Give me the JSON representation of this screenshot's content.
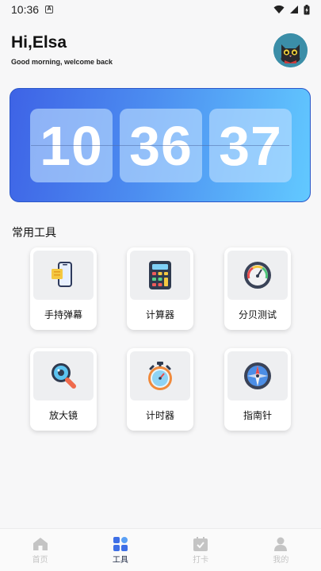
{
  "status_bar": {
    "time": "10:36",
    "notification_icon": "a-notification-icon",
    "wifi_icon": "wifi-icon",
    "signal_icon": "signal-icon",
    "battery_icon": "battery-charging-icon"
  },
  "header": {
    "greeting": "Hi,Elsa",
    "subtitle": "Good morning, welcome back",
    "avatar_icon": "cat-avatar-icon"
  },
  "clock": {
    "hours": "10",
    "minutes": "36",
    "seconds": "37"
  },
  "tools": {
    "section_title": "常用工具",
    "items": [
      {
        "label": "手持弹幕",
        "icon": "phone-marquee-icon"
      },
      {
        "label": "计算器",
        "icon": "calculator-icon"
      },
      {
        "label": "分贝测试",
        "icon": "decibel-meter-icon"
      },
      {
        "label": "放大镜",
        "icon": "magnifier-icon"
      },
      {
        "label": "计时器",
        "icon": "stopwatch-icon"
      },
      {
        "label": "指南针",
        "icon": "compass-icon"
      }
    ]
  },
  "bottom_nav": {
    "items": [
      {
        "label": "首页",
        "icon": "home-icon",
        "active": false
      },
      {
        "label": "工具",
        "icon": "tools-grid-icon",
        "active": true
      },
      {
        "label": "打卡",
        "icon": "calendar-check-icon",
        "active": false
      },
      {
        "label": "我的",
        "icon": "user-icon",
        "active": false
      }
    ]
  },
  "colors": {
    "card_gradient_start": "#3e63e6",
    "card_gradient_end": "#62c9ff",
    "nav_active": "#1f2a44",
    "nav_inactive": "#c4c4c4"
  }
}
